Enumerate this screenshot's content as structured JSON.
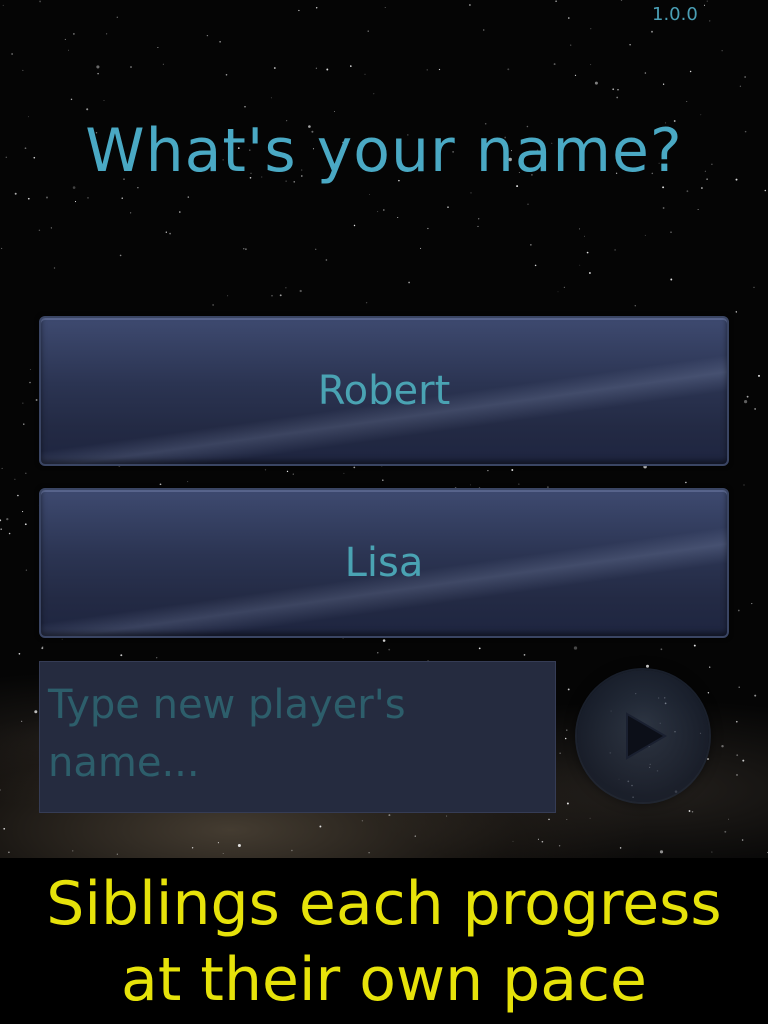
{
  "app": {
    "version": "1.0.0",
    "title": "What's your name?"
  },
  "players": [
    {
      "name": "Robert"
    },
    {
      "name": "Lisa"
    }
  ],
  "new_player": {
    "value": "",
    "placeholder": "Type new player's name..."
  },
  "go_button": {
    "icon": "play-arrow-icon"
  },
  "caption": {
    "line1": "Siblings each progress",
    "line2": "at their own pace"
  },
  "colors": {
    "title": "#4aa9c4",
    "button_text": "#4aa3b3",
    "caption": "#e6e20a",
    "placeholder": "#2d5e6b"
  }
}
